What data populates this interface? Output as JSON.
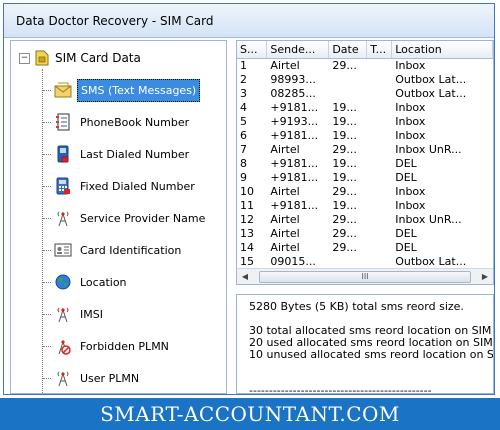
{
  "window": {
    "title": "Data Doctor Recovery - SIM Card"
  },
  "tree": {
    "root_label": "SIM Card Data",
    "items": [
      {
        "label": "SMS (Text Messages)",
        "icon": "envelope-icon"
      },
      {
        "label": "PhoneBook Number",
        "icon": "phonebook-icon"
      },
      {
        "label": "Last Dialed Number",
        "icon": "mobile-phone-icon"
      },
      {
        "label": "Fixed Dialed Number",
        "icon": "keypad-phone-icon"
      },
      {
        "label": "Service Provider Name",
        "icon": "antenna-icon"
      },
      {
        "label": "Card Identification",
        "icon": "id-card-icon"
      },
      {
        "label": "Location",
        "icon": "globe-icon"
      },
      {
        "label": "IMSI",
        "icon": "antenna-icon"
      },
      {
        "label": "Forbidden PLMN",
        "icon": "forbidden-antenna-icon"
      },
      {
        "label": "User PLMN",
        "icon": "antenna-icon"
      }
    ]
  },
  "grid": {
    "columns": [
      "S...",
      "Sende...",
      "Date",
      "T...",
      "Location"
    ],
    "rows": [
      [
        "1",
        "Airtel",
        "29...",
        "",
        "Inbox"
      ],
      [
        "2",
        "98993...",
        "",
        "",
        "Outbox Lat..."
      ],
      [
        "3",
        "08285...",
        "",
        "",
        "Outbox Lat..."
      ],
      [
        "4",
        "+9181...",
        "19...",
        "",
        "Inbox"
      ],
      [
        "5",
        "+9193...",
        "19...",
        "",
        "Inbox"
      ],
      [
        "6",
        "+9181...",
        "19...",
        "",
        "Inbox"
      ],
      [
        "7",
        "Airtel",
        "29...",
        "",
        "Inbox UnR..."
      ],
      [
        "8",
        "+9181...",
        "19...",
        "",
        "DEL"
      ],
      [
        "9",
        "+9181...",
        "19...",
        "",
        "DEL"
      ],
      [
        "10",
        "Airtel",
        "29...",
        "",
        "Inbox"
      ],
      [
        "11",
        "+9181...",
        "19...",
        "",
        "Inbox"
      ],
      [
        "12",
        "Airtel",
        "29...",
        "",
        "Inbox UnR..."
      ],
      [
        "13",
        "Airtel",
        "29...",
        "",
        "DEL"
      ],
      [
        "14",
        "Airtel",
        "29...",
        "",
        "DEL"
      ],
      [
        "15",
        "09015...",
        "",
        "",
        "Outbox Lat..."
      ]
    ],
    "scroll_grip": "III"
  },
  "summary": {
    "lines": [
      "5280 Bytes (5 KB) total sms reord size.",
      "",
      "30 total allocated sms reord location on SIM",
      "20 used allocated sms reord location on SIM",
      "10 unused allocated sms reord location on S",
      "",
      "",
      "----------------------------------------------"
    ]
  },
  "banner": {
    "text": "SMART-ACCOUNTANT.COM"
  },
  "colors": {
    "banner_bg": "#1b73c6",
    "selection": "#3b8ce0",
    "title_gradient": "#d4e3f5"
  }
}
